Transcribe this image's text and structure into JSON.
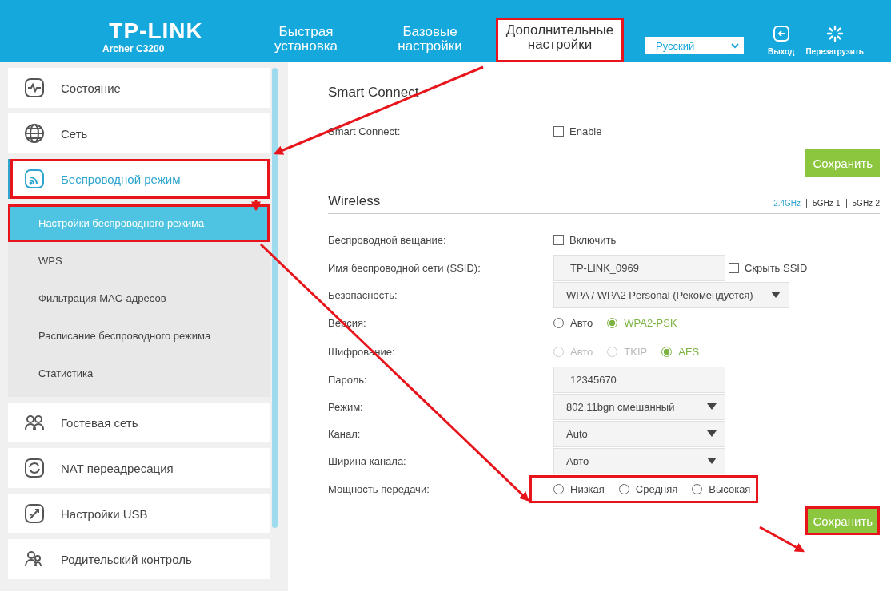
{
  "header": {
    "logo": "TP-LINK",
    "model": "Archer C3200",
    "tabs": [
      {
        "label": "Быстрая установка",
        "selected": false,
        "highlighted": false
      },
      {
        "label": "Базовые настройки",
        "selected": false,
        "highlighted": false
      },
      {
        "label": "Дополнительные настройки",
        "selected": true,
        "highlighted": true
      }
    ],
    "language": "Русский",
    "actions": [
      {
        "kind": "logout",
        "label": "Выход"
      },
      {
        "kind": "reboot",
        "label": "Перезагрузить"
      }
    ]
  },
  "sidebar": {
    "items": [
      {
        "kind": "status",
        "label": "Состояние",
        "selected": false,
        "highlighted": false
      },
      {
        "kind": "globe",
        "label": "Сеть",
        "selected": false,
        "highlighted": false
      },
      {
        "kind": "wireless",
        "label": "Беспроводной режим",
        "selected": true,
        "highlighted": true,
        "children": [
          {
            "label": "Настройки беспроводного режима",
            "selected": true,
            "highlighted": true
          },
          {
            "label": "WPS",
            "selected": false,
            "highlighted": false
          },
          {
            "label": "Фильтрация MAC-адресов",
            "selected": false,
            "highlighted": false
          },
          {
            "label": "Расписание беспроводного режима",
            "selected": false,
            "highlighted": false
          },
          {
            "label": "Статистика",
            "selected": false,
            "highlighted": false
          }
        ]
      },
      {
        "kind": "guests",
        "label": "Гостевая сеть",
        "selected": false,
        "highlighted": false
      },
      {
        "kind": "nat",
        "label": "NAT переадресация",
        "selected": false,
        "highlighted": false
      },
      {
        "kind": "usb",
        "label": "Настройки USB",
        "selected": false,
        "highlighted": false
      },
      {
        "kind": "parental",
        "label": "Родительский контроль",
        "selected": false,
        "highlighted": false
      }
    ]
  },
  "sections": [
    {
      "title": "Smart Connect",
      "rows": [
        {
          "kind": "checkbox",
          "label": "Smart Connect:",
          "option": {
            "label": "Enable",
            "checked": false
          }
        }
      ],
      "save": {
        "label": "Сохранить",
        "highlighted": false
      }
    },
    {
      "title": "Wireless",
      "bands": [
        {
          "label": "2.4GHz",
          "selected": true
        },
        {
          "label": "5GHz-1",
          "selected": false
        },
        {
          "label": "5GHz-2",
          "selected": false
        }
      ],
      "rows": [
        {
          "kind": "checkbox",
          "label": "Беспроводной вещание:",
          "option": {
            "label": "Включить",
            "checked": false
          }
        },
        {
          "kind": "text",
          "label": "Имя беспроводной сети (SSID):",
          "value": "TP-LINK_0969",
          "option": {
            "label": "Скрыть SSID",
            "checked": false
          }
        },
        {
          "kind": "select",
          "label": "Безопасность:",
          "value": "WPA / WPA2 Personal (Рекомендуется)"
        },
        {
          "kind": "radio",
          "label": "Версия:",
          "highlighted": false,
          "options": [
            {
              "label": "Авто",
              "selected": false,
              "disabled": false
            },
            {
              "label": "WPA2-PSK",
              "selected": true,
              "disabled": false
            }
          ]
        },
        {
          "kind": "radio",
          "label": "Шифрование:",
          "highlighted": false,
          "options": [
            {
              "label": "Авто",
              "selected": false,
              "disabled": true
            },
            {
              "label": "TKIP",
              "selected": false,
              "disabled": true
            },
            {
              "label": "AES",
              "selected": true,
              "disabled": false
            }
          ]
        },
        {
          "kind": "text",
          "label": "Пароль:",
          "value": "12345670"
        },
        {
          "kind": "select",
          "label": "Режим:",
          "value": "802.11bgn смешанный"
        },
        {
          "kind": "select",
          "label": "Канал:",
          "value": "Auto"
        },
        {
          "kind": "select",
          "label": "Ширина канала:",
          "value": "Авто"
        },
        {
          "kind": "radio",
          "label": "Мощность передачи:",
          "highlighted": true,
          "options": [
            {
              "label": "Низкая",
              "selected": false,
              "disabled": false
            },
            {
              "label": "Средняя",
              "selected": false,
              "disabled": false
            },
            {
              "label": "Высокая",
              "selected": false,
              "disabled": false
            }
          ]
        }
      ],
      "save": {
        "label": "Сохранить",
        "highlighted": true
      }
    }
  ]
}
